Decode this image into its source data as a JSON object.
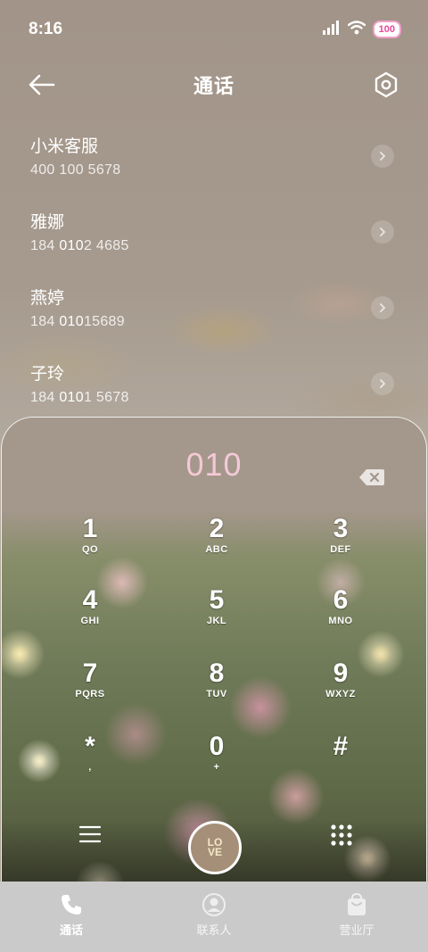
{
  "status_bar": {
    "time": "8:16",
    "battery": "100"
  },
  "header": {
    "title": "通话"
  },
  "contacts": [
    {
      "name": "小米客服",
      "number_pre": "400 100 5678",
      "number_hl": "",
      "number_post": ""
    },
    {
      "name": "雅娜",
      "number_pre": "184 ",
      "number_hl": "010",
      "number_post": "2 4685"
    },
    {
      "name": "燕婷",
      "number_pre": "184 ",
      "number_hl": "010",
      "number_post": "15689"
    },
    {
      "name": "子玲",
      "number_pre": "184 ",
      "number_hl": "010",
      "number_post": "1 5678"
    }
  ],
  "dialer": {
    "number": "010",
    "keys": [
      {
        "digit": "1",
        "letters": "QO"
      },
      {
        "digit": "2",
        "letters": "ABC"
      },
      {
        "digit": "3",
        "letters": "DEF"
      },
      {
        "digit": "4",
        "letters": "GHI"
      },
      {
        "digit": "5",
        "letters": "JKL"
      },
      {
        "digit": "6",
        "letters": "MNO"
      },
      {
        "digit": "7",
        "letters": "PQRS"
      },
      {
        "digit": "8",
        "letters": "TUV"
      },
      {
        "digit": "9",
        "letters": "WXYZ"
      },
      {
        "digit": "*",
        "letters": ","
      },
      {
        "digit": "0",
        "letters": "+"
      },
      {
        "digit": "#",
        "letters": ""
      }
    ],
    "call_label_top": "LO",
    "call_label_bottom": "VE"
  },
  "tabs": [
    {
      "label": "通话",
      "icon": "phone-icon",
      "active": true
    },
    {
      "label": "联系人",
      "icon": "person-icon",
      "active": false
    },
    {
      "label": "营业厅",
      "icon": "bag-icon",
      "active": false
    }
  ],
  "colors": {
    "dial_number": "#f4c9d6",
    "battery_text": "#e8489a",
    "call_button": "#a58f78",
    "tab_bar": "#cacaca"
  }
}
